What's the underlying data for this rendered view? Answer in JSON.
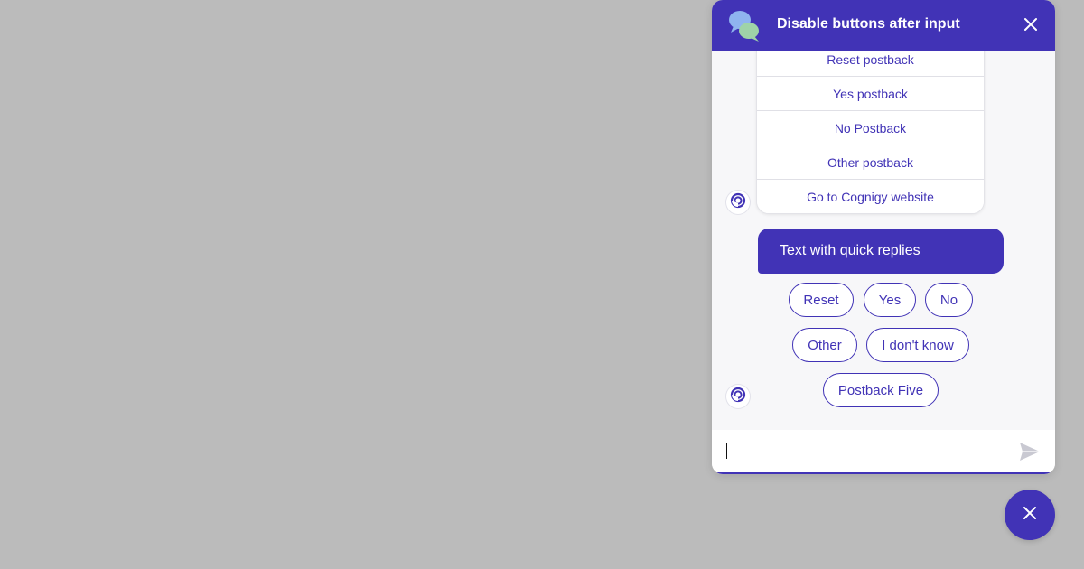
{
  "header": {
    "title": "Disable buttons after input",
    "logo_icon": "chat-bubbles-icon",
    "close_icon": "close-icon"
  },
  "button_list": {
    "items": [
      {
        "label": "Reset postback"
      },
      {
        "label": "Yes postback"
      },
      {
        "label": "No Postback"
      },
      {
        "label": "Other postback"
      },
      {
        "label": "Go to Cognigy website"
      }
    ]
  },
  "bot_message": {
    "text": "Text with quick replies"
  },
  "quick_replies": [
    {
      "label": "Reset"
    },
    {
      "label": "Yes"
    },
    {
      "label": "No"
    },
    {
      "label": "Other"
    },
    {
      "label": "I don't know"
    },
    {
      "label": "Postback Five"
    }
  ],
  "input": {
    "value": "",
    "placeholder": "",
    "send_icon": "send-icon"
  },
  "toggle": {
    "icon": "close-icon"
  },
  "colors": {
    "accent": "#4133b6",
    "background": "#bbbbbb",
    "chat_background": "#f7f7f9",
    "white": "#ffffff"
  }
}
